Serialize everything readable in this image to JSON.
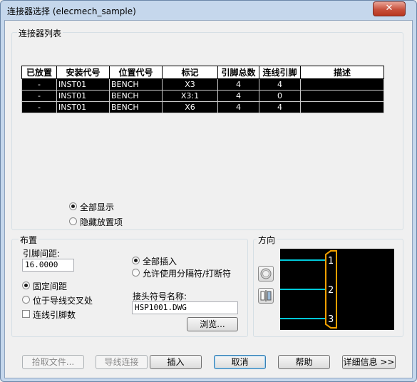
{
  "window": {
    "title": "连接器选择 (elecmech_sample)",
    "close": "✕"
  },
  "list_group": {
    "label": "连接器列表",
    "columns": [
      "已放置",
      "安装代号",
      "位置代号",
      "标记",
      "引脚总数",
      "连线引脚",
      "描述"
    ],
    "rows": [
      [
        "-",
        "INST01",
        "BENCH",
        "X3",
        "4",
        "4",
        ""
      ],
      [
        "-",
        "INST01",
        "BENCH",
        "X3:1",
        "4",
        "0",
        ""
      ],
      [
        "-",
        "INST01",
        "BENCH",
        "X6",
        "4",
        "4",
        ""
      ]
    ],
    "show_all": "全部显示",
    "hide_placed": "隐藏放置项"
  },
  "layout_group": {
    "label": "布置",
    "pin_spacing_label": "引脚间距:",
    "pin_spacing_value": "16.0000",
    "fixed_spacing": "固定间距",
    "at_wire_crossing": "位于导线交叉处",
    "wire_pin_count": "连线引脚数",
    "insert_all": "全部插入",
    "allow_separator": "允许使用分隔符/打断符",
    "connector_symbol_label": "接头符号名称:",
    "connector_symbol_value": "HSP1001.DWG",
    "browse": "浏览..."
  },
  "direction_group": {
    "label": "方向",
    "pins": [
      "1",
      "2",
      "3"
    ],
    "colors": {
      "wire": "#00c8d8",
      "outline": "#f0a000"
    }
  },
  "footer": {
    "pick_file": "拾取文件...",
    "wire_connect": "导线连接",
    "insert": "插入",
    "cancel": "取消",
    "help": "帮助",
    "details": "详细信息 >>"
  }
}
